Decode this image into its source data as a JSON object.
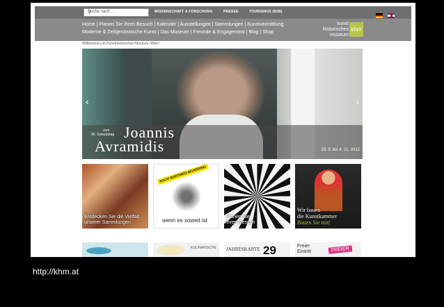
{
  "search": {
    "placeholder": "Suche nach ...",
    "icon": "search-icon"
  },
  "top_links": [
    "WISSENSCHAFT & FORSCHUNG",
    "PRESSE",
    "TOURISMUS (B2B)"
  ],
  "nav": {
    "row1": [
      "Home",
      "Planen Sie Ihren Besuch",
      "Kalender",
      "Ausstellungen",
      "Sammlungen",
      "Kunstvermittlung"
    ],
    "row2": [
      "Moderne & Zeitgenössische Kunst",
      "Das Museum",
      "Freunde & Engagement",
      "Blog",
      "Shop"
    ]
  },
  "logo": {
    "line1": "kunst",
    "line2": "historisches",
    "line3": "museum",
    "mark": "khm"
  },
  "welcome": "Willkommen im Kunsthistorischen Museum, Wien!",
  "hero": {
    "small_line1": "zum",
    "small_line2": "90. Geburtstag",
    "name_line1": "Joannis",
    "name_line2": "Avramidis",
    "date": "19. 9. bis 4. 11. 2012",
    "prev": "‹",
    "next": "›"
  },
  "tiles": [
    {
      "line1": "Entdecken Sie die Vielfalt",
      "line2": "unserer Sammlungen"
    },
    {
      "label": "NACH BARTMEG BOARDING",
      "caption": "wenn es soweit ist"
    },
    {
      "line1": "Planen Sie",
      "line2": "Ihren Besuch"
    },
    {
      "line1": "Wir bauen",
      "line2": "die Kunstkammer",
      "line3": "Bauen Sie mit!"
    }
  ],
  "bottom": {
    "b2_label": "KULINARISCHE",
    "b3_label": "JAHRESKARTE",
    "b3_number": "29",
    "b4_line1": "Freier",
    "b4_line2": "Eintritt",
    "b4_tag": "FREIER"
  },
  "url": "http://khm.at",
  "colors": {
    "accent": "#b7c64a",
    "nav_bg": "#8a8a8a",
    "topbar_bg": "#6f6f6f"
  }
}
